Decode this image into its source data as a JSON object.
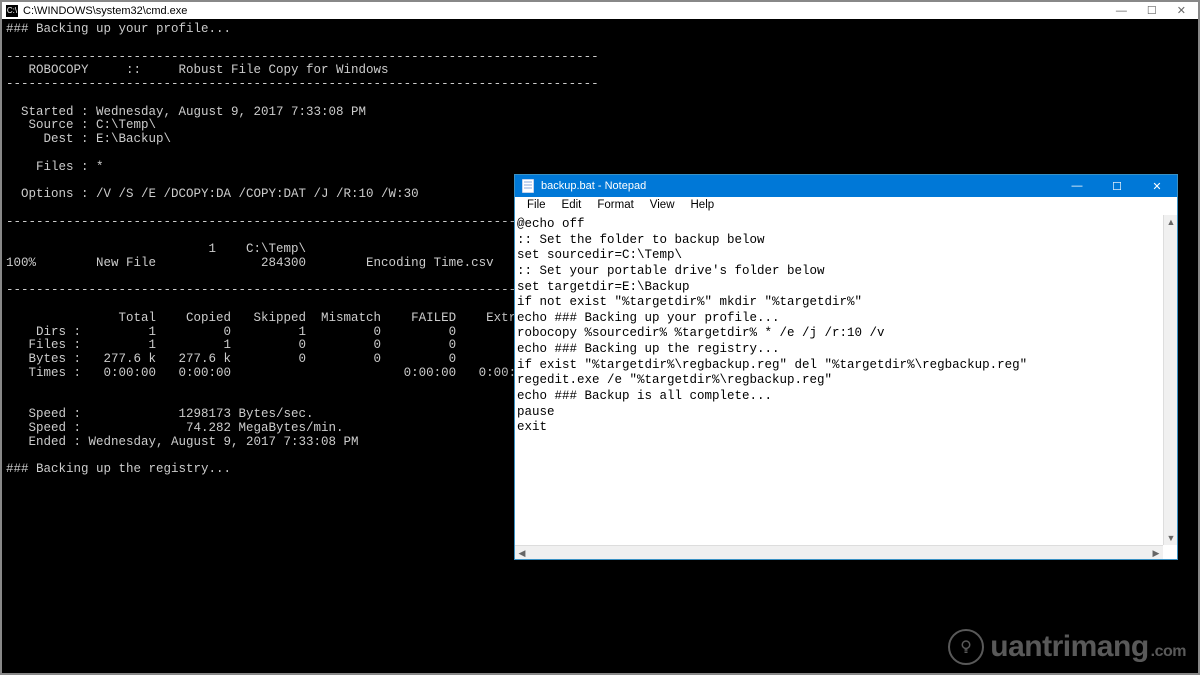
{
  "cmd": {
    "title": "C:\\WINDOWS\\system32\\cmd.exe",
    "body": "### Backing up your profile...\n\n-------------------------------------------------------------------------------\n   ROBOCOPY     ::     Robust File Copy for Windows\n-------------------------------------------------------------------------------\n\n  Started : Wednesday, August 9, 2017 7:33:08 PM\n   Source : C:\\Temp\\\n     Dest : E:\\Backup\\\n\n    Files : *\n\n  Options : /V /S /E /DCOPY:DA /COPY:DAT /J /R:10 /W:30\n\n------------------------------------------------------------------------------\n\n                           1    C:\\Temp\\\n100%        New File              284300        Encoding Time.csv\n\n------------------------------------------------------------------------------\n\n               Total    Copied   Skipped  Mismatch    FAILED    Extras\n    Dirs :         1         0         1         0         0         0\n   Files :         1         1         0         0         0         0\n   Bytes :   277.6 k   277.6 k         0         0         0         0\n   Times :   0:00:00   0:00:00                       0:00:00   0:00:00\n\n\n   Speed :             1298173 Bytes/sec.\n   Speed :              74.282 MegaBytes/min.\n   Ended : Wednesday, August 9, 2017 7:33:08 PM\n\n### Backing up the registry...\n"
  },
  "notepad": {
    "title": "backup.bat - Notepad",
    "menu": {
      "file": "File",
      "edit": "Edit",
      "format": "Format",
      "view": "View",
      "help": "Help"
    },
    "content": "@echo off\n:: Set the folder to backup below\nset sourcedir=C:\\Temp\\\n:: Set your portable drive's folder below\nset targetdir=E:\\Backup\nif not exist \"%targetdir%\" mkdir \"%targetdir%\"\necho ### Backing up your profile...\nrobocopy %sourcedir% %targetdir% * /e /j /r:10 /v\necho ### Backing up the registry...\nif exist \"%targetdir%\\regbackup.reg\" del \"%targetdir%\\regbackup.reg\"\nregedit.exe /e \"%targetdir%\\regbackup.reg\"\necho ### Backup is all complete...\npause\nexit"
  },
  "watermark": {
    "text": "uantrimang",
    "dotcom": ".com"
  }
}
